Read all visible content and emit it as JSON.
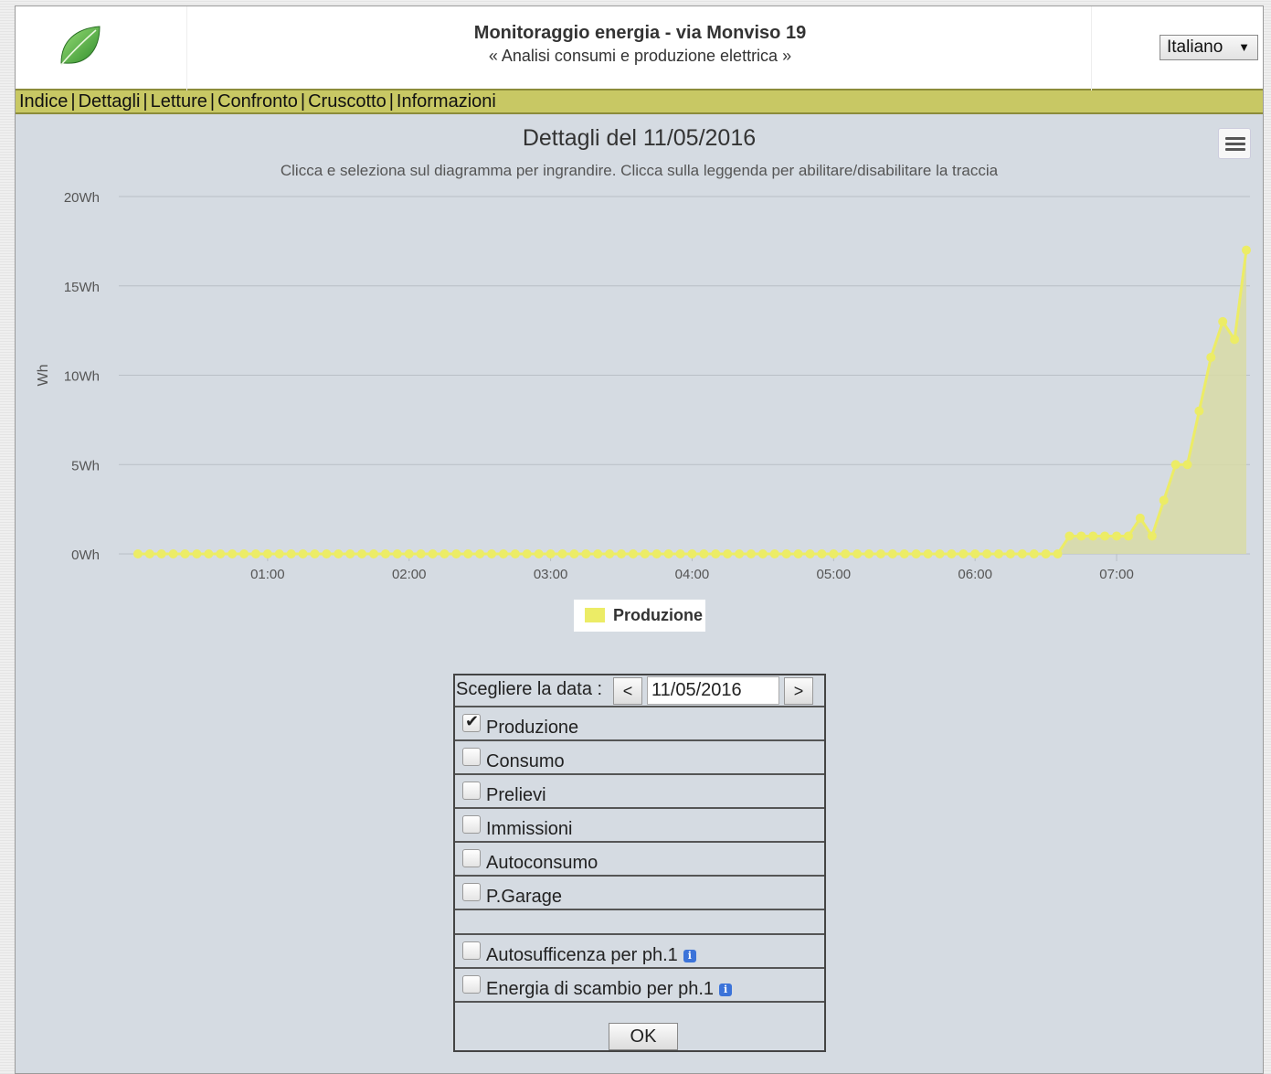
{
  "header": {
    "title": "Monitoraggio energia - via Monviso 19",
    "subtitle": "« Analisi consumi e produzione elettrica »",
    "language": "Italiano",
    "logo": "leaf-icon"
  },
  "nav": {
    "items": [
      "Indice",
      "Dettagli",
      "Letture",
      "Confronto",
      "Cruscotto",
      "Informazioni"
    ]
  },
  "chart_data": {
    "type": "area",
    "title": "Dettagli del 11/05/2016",
    "subtitle": "Clicca e seleziona sul diagramma per ingrandire. Clicca sulla leggenda per abilitare/disabilitare la traccia",
    "ylabel": "Wh",
    "xlabel": "",
    "ylim": [
      0,
      20
    ],
    "y_ticks": [
      "0Wh",
      "5Wh",
      "10Wh",
      "15Wh",
      "20Wh"
    ],
    "x_ticks": [
      "01:00",
      "02:00",
      "03:00",
      "04:00",
      "05:00",
      "06:00",
      "07:00"
    ],
    "x_range_minutes": [
      0,
      475
    ],
    "grid": true,
    "legend": "bottom-center",
    "colors": {
      "series": "#ecec66",
      "fill": "#d8dba6"
    },
    "series": [
      {
        "name": "Produzione",
        "interval_minutes": 5,
        "zero_until_minutes": 395,
        "values_from_400": [
          1,
          1,
          1,
          1,
          1,
          1,
          2,
          1,
          3,
          5,
          5,
          8,
          11,
          13,
          12,
          17
        ]
      }
    ]
  },
  "form": {
    "date_label": "Scegliere la data :",
    "prev": "<",
    "next": ">",
    "date_value": "11/05/2016",
    "options": [
      {
        "label": "Produzione",
        "checked": true
      },
      {
        "label": "Consumo",
        "checked": false
      },
      {
        "label": "Prelievi",
        "checked": false
      },
      {
        "label": "Immissioni",
        "checked": false
      },
      {
        "label": "Autoconsumo",
        "checked": false
      },
      {
        "label": "P.Garage",
        "checked": false
      }
    ],
    "extra_options": [
      {
        "label": "Autosufficenza per ph.1",
        "checked": false,
        "icon": "info-icon"
      },
      {
        "label": "Energia di scambio per ph.1",
        "checked": false,
        "icon": "info-icon"
      }
    ],
    "ok": "OK"
  }
}
